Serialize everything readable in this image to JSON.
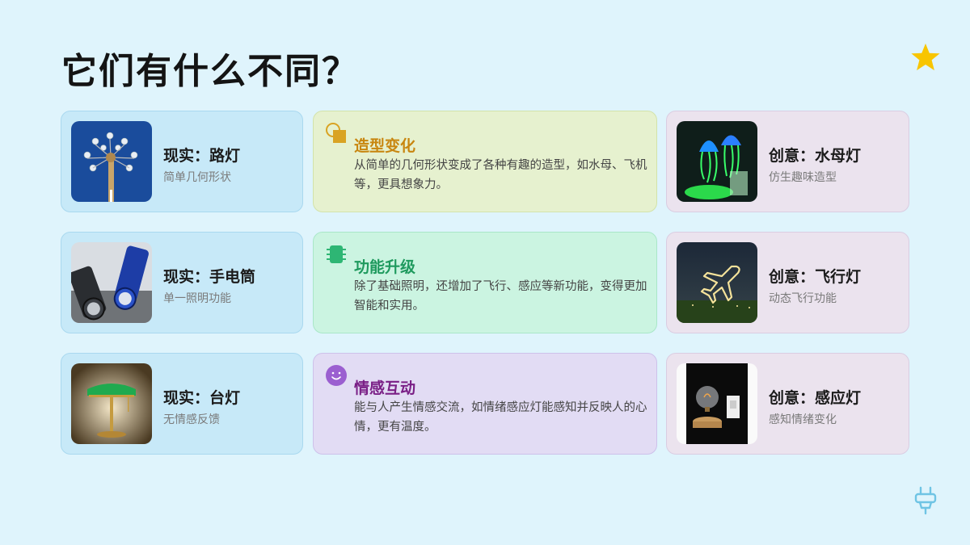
{
  "title": "它们有什么不同？",
  "real_items": [
    {
      "title": "现实：路灯",
      "subtitle": "简单几何形状",
      "thumb_icon": "street-lamp-photo"
    },
    {
      "title": "现实：手电筒",
      "subtitle": "单一照明功能",
      "thumb_icon": "flashlight-photo"
    },
    {
      "title": "现实：台灯",
      "subtitle": "无情感反馈",
      "thumb_icon": "desk-lamp-photo"
    }
  ],
  "differences": [
    {
      "heading": "造型变化",
      "description": "从简单的几何形状变成了各种有趣的造型，如水母、飞机等，更具想象力。",
      "icon": "shapes-icon",
      "color": "#c8860f"
    },
    {
      "heading": "功能升级",
      "description": "除了基础照明，还增加了飞行、感应等新功能，变得更加智能和实用。",
      "icon": "chip-icon",
      "color": "#1f9a5e"
    },
    {
      "heading": "情感互动",
      "description": "能与人产生情感交流，如情绪感应灯能感知并反映人的心情，更有温度。",
      "icon": "smile-icon",
      "color": "#7a1f86"
    }
  ],
  "creative_items": [
    {
      "title": "创意：水母灯",
      "subtitle": "仿生趣味造型",
      "thumb_icon": "jellyfish-lamp-photo"
    },
    {
      "title": "创意：飞行灯",
      "subtitle": "动态飞行功能",
      "thumb_icon": "airplane-light-photo"
    },
    {
      "title": "创意：感应灯",
      "subtitle": "感知情绪变化",
      "thumb_icon": "bulb-lamp-photo"
    }
  ],
  "decorations": {
    "star": "star-icon",
    "plug": "plug-icon"
  }
}
